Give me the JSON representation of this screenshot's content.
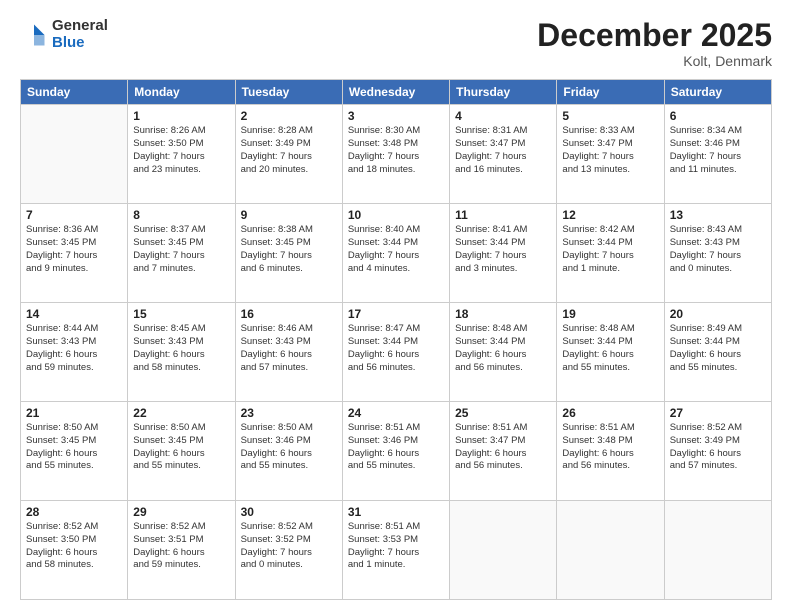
{
  "header": {
    "logo_general": "General",
    "logo_blue": "Blue",
    "month_title": "December 2025",
    "subtitle": "Kolt, Denmark"
  },
  "days_of_week": [
    "Sunday",
    "Monday",
    "Tuesday",
    "Wednesday",
    "Thursday",
    "Friday",
    "Saturday"
  ],
  "weeks": [
    [
      {
        "day": "",
        "info": ""
      },
      {
        "day": "1",
        "info": "Sunrise: 8:26 AM\nSunset: 3:50 PM\nDaylight: 7 hours\nand 23 minutes."
      },
      {
        "day": "2",
        "info": "Sunrise: 8:28 AM\nSunset: 3:49 PM\nDaylight: 7 hours\nand 20 minutes."
      },
      {
        "day": "3",
        "info": "Sunrise: 8:30 AM\nSunset: 3:48 PM\nDaylight: 7 hours\nand 18 minutes."
      },
      {
        "day": "4",
        "info": "Sunrise: 8:31 AM\nSunset: 3:47 PM\nDaylight: 7 hours\nand 16 minutes."
      },
      {
        "day": "5",
        "info": "Sunrise: 8:33 AM\nSunset: 3:47 PM\nDaylight: 7 hours\nand 13 minutes."
      },
      {
        "day": "6",
        "info": "Sunrise: 8:34 AM\nSunset: 3:46 PM\nDaylight: 7 hours\nand 11 minutes."
      }
    ],
    [
      {
        "day": "7",
        "info": "Sunrise: 8:36 AM\nSunset: 3:45 PM\nDaylight: 7 hours\nand 9 minutes."
      },
      {
        "day": "8",
        "info": "Sunrise: 8:37 AM\nSunset: 3:45 PM\nDaylight: 7 hours\nand 7 minutes."
      },
      {
        "day": "9",
        "info": "Sunrise: 8:38 AM\nSunset: 3:45 PM\nDaylight: 7 hours\nand 6 minutes."
      },
      {
        "day": "10",
        "info": "Sunrise: 8:40 AM\nSunset: 3:44 PM\nDaylight: 7 hours\nand 4 minutes."
      },
      {
        "day": "11",
        "info": "Sunrise: 8:41 AM\nSunset: 3:44 PM\nDaylight: 7 hours\nand 3 minutes."
      },
      {
        "day": "12",
        "info": "Sunrise: 8:42 AM\nSunset: 3:44 PM\nDaylight: 7 hours\nand 1 minute."
      },
      {
        "day": "13",
        "info": "Sunrise: 8:43 AM\nSunset: 3:43 PM\nDaylight: 7 hours\nand 0 minutes."
      }
    ],
    [
      {
        "day": "14",
        "info": "Sunrise: 8:44 AM\nSunset: 3:43 PM\nDaylight: 6 hours\nand 59 minutes."
      },
      {
        "day": "15",
        "info": "Sunrise: 8:45 AM\nSunset: 3:43 PM\nDaylight: 6 hours\nand 58 minutes."
      },
      {
        "day": "16",
        "info": "Sunrise: 8:46 AM\nSunset: 3:43 PM\nDaylight: 6 hours\nand 57 minutes."
      },
      {
        "day": "17",
        "info": "Sunrise: 8:47 AM\nSunset: 3:44 PM\nDaylight: 6 hours\nand 56 minutes."
      },
      {
        "day": "18",
        "info": "Sunrise: 8:48 AM\nSunset: 3:44 PM\nDaylight: 6 hours\nand 56 minutes."
      },
      {
        "day": "19",
        "info": "Sunrise: 8:48 AM\nSunset: 3:44 PM\nDaylight: 6 hours\nand 55 minutes."
      },
      {
        "day": "20",
        "info": "Sunrise: 8:49 AM\nSunset: 3:44 PM\nDaylight: 6 hours\nand 55 minutes."
      }
    ],
    [
      {
        "day": "21",
        "info": "Sunrise: 8:50 AM\nSunset: 3:45 PM\nDaylight: 6 hours\nand 55 minutes."
      },
      {
        "day": "22",
        "info": "Sunrise: 8:50 AM\nSunset: 3:45 PM\nDaylight: 6 hours\nand 55 minutes."
      },
      {
        "day": "23",
        "info": "Sunrise: 8:50 AM\nSunset: 3:46 PM\nDaylight: 6 hours\nand 55 minutes."
      },
      {
        "day": "24",
        "info": "Sunrise: 8:51 AM\nSunset: 3:46 PM\nDaylight: 6 hours\nand 55 minutes."
      },
      {
        "day": "25",
        "info": "Sunrise: 8:51 AM\nSunset: 3:47 PM\nDaylight: 6 hours\nand 56 minutes."
      },
      {
        "day": "26",
        "info": "Sunrise: 8:51 AM\nSunset: 3:48 PM\nDaylight: 6 hours\nand 56 minutes."
      },
      {
        "day": "27",
        "info": "Sunrise: 8:52 AM\nSunset: 3:49 PM\nDaylight: 6 hours\nand 57 minutes."
      }
    ],
    [
      {
        "day": "28",
        "info": "Sunrise: 8:52 AM\nSunset: 3:50 PM\nDaylight: 6 hours\nand 58 minutes."
      },
      {
        "day": "29",
        "info": "Sunrise: 8:52 AM\nSunset: 3:51 PM\nDaylight: 6 hours\nand 59 minutes."
      },
      {
        "day": "30",
        "info": "Sunrise: 8:52 AM\nSunset: 3:52 PM\nDaylight: 7 hours\nand 0 minutes."
      },
      {
        "day": "31",
        "info": "Sunrise: 8:51 AM\nSunset: 3:53 PM\nDaylight: 7 hours\nand 1 minute."
      },
      {
        "day": "",
        "info": ""
      },
      {
        "day": "",
        "info": ""
      },
      {
        "day": "",
        "info": ""
      }
    ]
  ]
}
